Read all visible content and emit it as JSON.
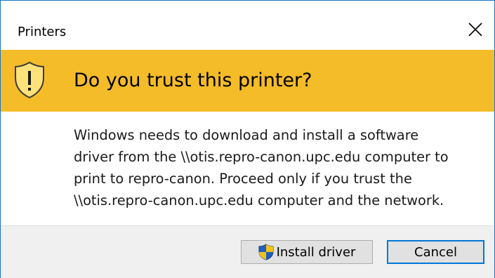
{
  "window": {
    "title": "Printers",
    "close_icon": "close-icon"
  },
  "banner": {
    "icon": "warning-shield-icon",
    "heading": "Do you trust this printer?",
    "color": "#f4bc28"
  },
  "message": {
    "text": "Windows needs to download and install a software\ndriver from the \\\\otis.repro-canon.upc.edu computer to\nprint to repro-canon.  Proceed only if you trust the\n\\\\otis.repro-canon.upc.edu computer and the network."
  },
  "buttons": {
    "install_label": "Install driver",
    "install_icon": "uac-shield-icon",
    "cancel_label": "Cancel"
  },
  "colors": {
    "accent": "#0078d7",
    "border": "#1a73c9"
  }
}
